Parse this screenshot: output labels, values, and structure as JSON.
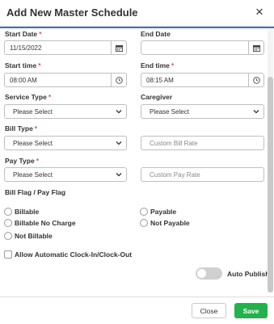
{
  "dialog": {
    "title": "Add New Master Schedule",
    "close_icon": "×"
  },
  "form": {
    "start_date": {
      "label": "Start Date",
      "value": "11/15/2022",
      "icon": "calendar-icon"
    },
    "end_date": {
      "label": "End Date",
      "value": "",
      "icon": "calendar-icon"
    },
    "start_time": {
      "label": "Start time",
      "value": "08:00 AM",
      "icon": "clock-icon"
    },
    "end_time": {
      "label": "End time",
      "value": "08:15 AM",
      "icon": "clock-icon"
    },
    "service_type": {
      "label": "Service Type",
      "value": "Please Select"
    },
    "caregiver": {
      "label": "Caregiver",
      "value": "Please Select"
    },
    "bill_type": {
      "label": "Bill Type",
      "value": "Please Select"
    },
    "custom_bill_rate": {
      "placeholder": "Custom Bill Rate"
    },
    "pay_type": {
      "label": "Pay Type",
      "value": "Please Select"
    },
    "custom_pay_rate": {
      "placeholder": "Custom Pay Rate"
    },
    "flags": {
      "label": "Bill Flag / Pay Flag",
      "options": [
        "Billable",
        "Payable",
        "Billable No Charge",
        "Not Payable",
        "Not Billable"
      ]
    },
    "auto_clock": {
      "label": "Allow Automatic Clock-In/Clock-Out",
      "checked": false
    },
    "auto_publish": {
      "label": "Auto Publish",
      "on": false
    }
  },
  "required_marker": "*",
  "footer": {
    "close_label": "Close",
    "save_label": "Save"
  },
  "colors": {
    "save_bg": "#21b24b",
    "required": "#d9534f",
    "accent_line": "#3b6fd1"
  }
}
